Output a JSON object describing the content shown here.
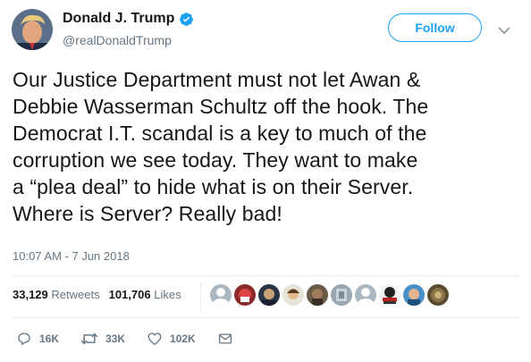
{
  "author": {
    "display_name": "Donald J. Trump",
    "handle": "@realDonaldTrump",
    "verified": true
  },
  "header": {
    "follow_label": "Follow"
  },
  "tweet": {
    "lines": [
      "Our Justice Department must not let Awan &",
      "Debbie Wasserman Schultz off the hook. The",
      "Democrat I.T. scandal is a key to much of the",
      "corruption we see today. They want to make",
      "a “plea deal” to hide what is on their Server.",
      "Where is Server? Really bad!"
    ],
    "timestamp": "10:07 AM - 7 Jun 2018"
  },
  "stats": {
    "retweets_count": "33,129",
    "retweets_label": "Retweets",
    "likes_count": "101,706",
    "likes_label": "Likes"
  },
  "likers": [
    {
      "icon": "default-avatar-icon"
    },
    {
      "icon": "user-avatar"
    },
    {
      "icon": "user-avatar"
    },
    {
      "icon": "user-avatar"
    },
    {
      "icon": "user-avatar"
    },
    {
      "icon": "default-avatar-icon"
    },
    {
      "icon": "user-avatar"
    },
    {
      "icon": "user-avatar"
    },
    {
      "icon": "user-avatar"
    }
  ],
  "actions": {
    "reply_count": "16K",
    "retweet_count": "33K",
    "like_count": "102K"
  },
  "colors": {
    "accent": "#1da1f2",
    "text": "#14171a",
    "muted": "#657786",
    "divider": "#e6ecf0"
  }
}
